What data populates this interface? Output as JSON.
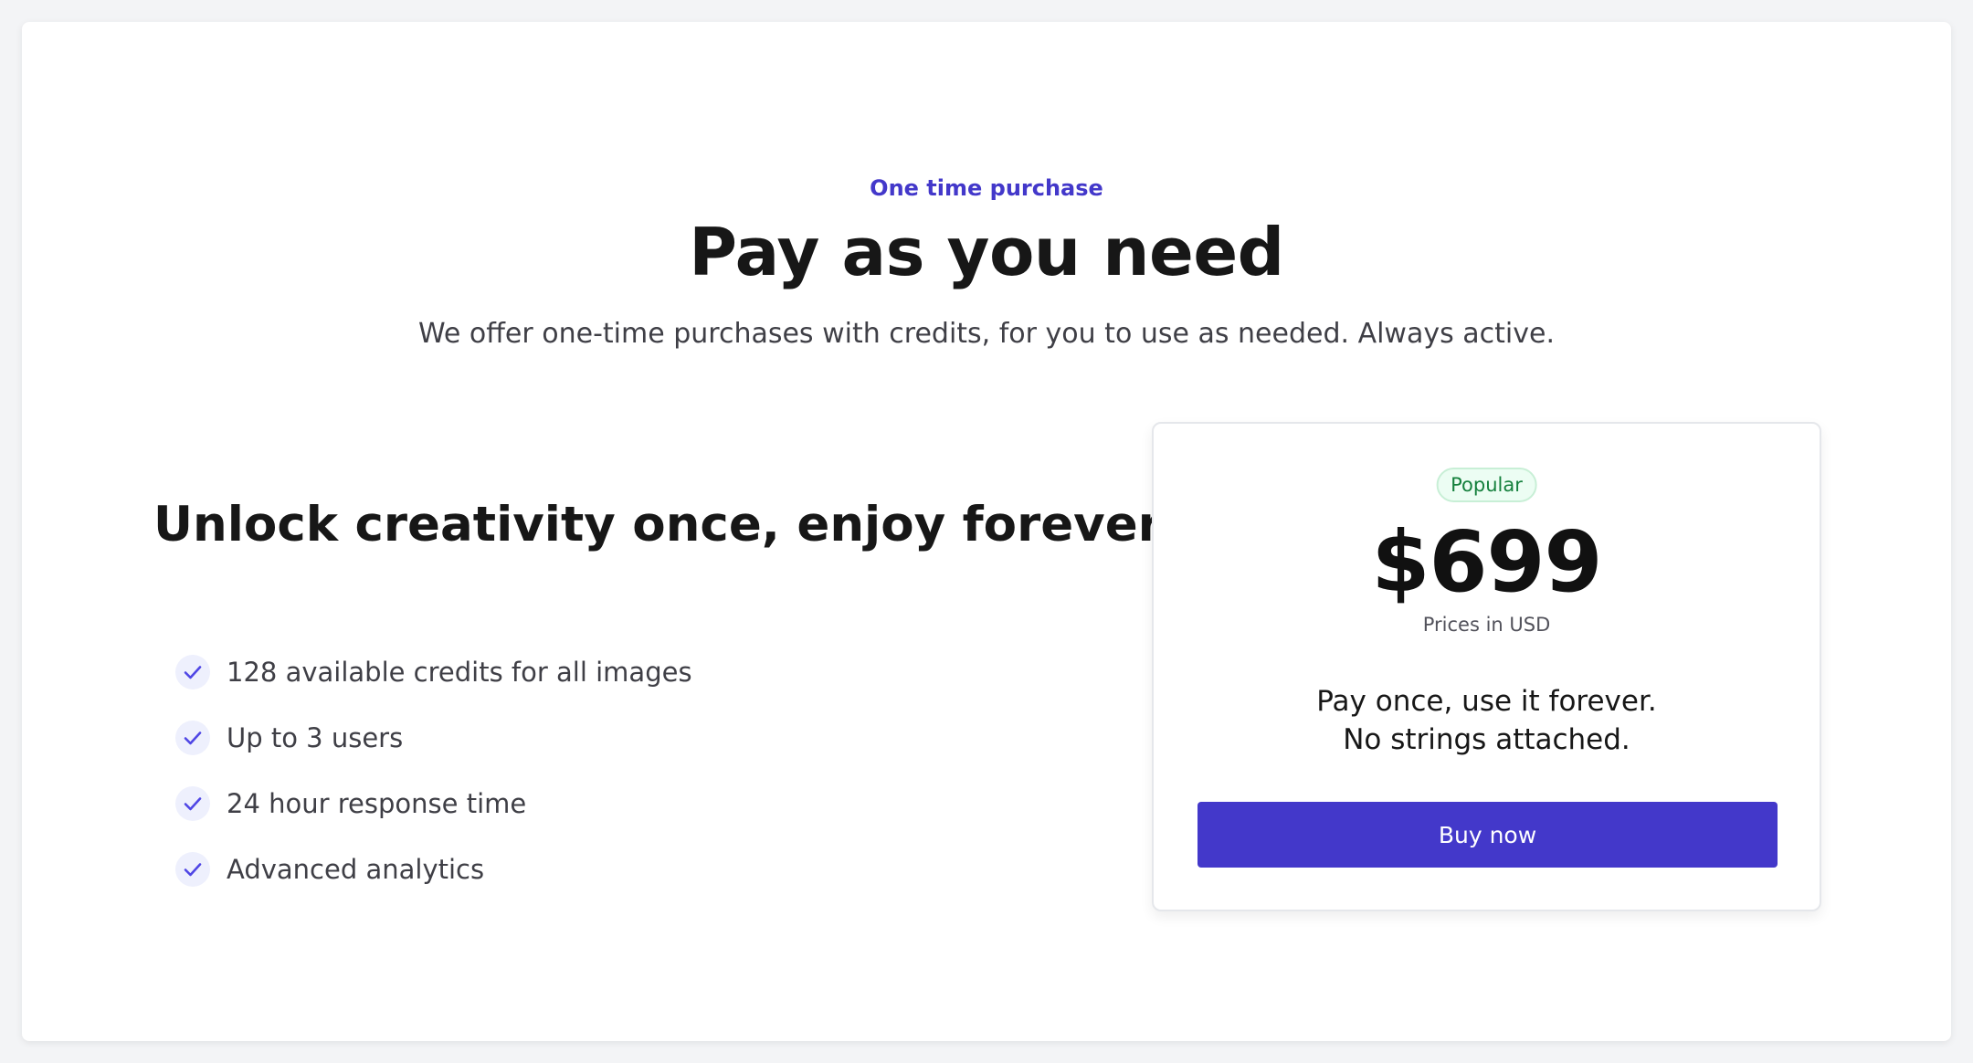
{
  "header": {
    "eyebrow": "One time purchase",
    "title": "Pay as you need",
    "subtitle": "We offer one-time purchases with credits, for you to use as needed. Always active."
  },
  "features": {
    "heading": "Unlock creativity once, enjoy forever",
    "items": [
      {
        "label": "128 available credits for all images",
        "icon": "check-icon"
      },
      {
        "label": "Up to 3 users",
        "icon": "check-icon"
      },
      {
        "label": "24 hour response time",
        "icon": "check-icon"
      },
      {
        "label": "Advanced analytics",
        "icon": "check-icon"
      }
    ]
  },
  "pricing": {
    "badge": "Popular",
    "price": "$699",
    "note": "Prices in USD",
    "description_line1": "Pay once, use it forever.",
    "description_line2": "No strings attached.",
    "button_label": "Buy now"
  },
  "colors": {
    "accent": "#4338ca",
    "badge_text": "#15803d",
    "badge_bg": "#ecfdf3",
    "check_bg": "#eef0fd"
  }
}
